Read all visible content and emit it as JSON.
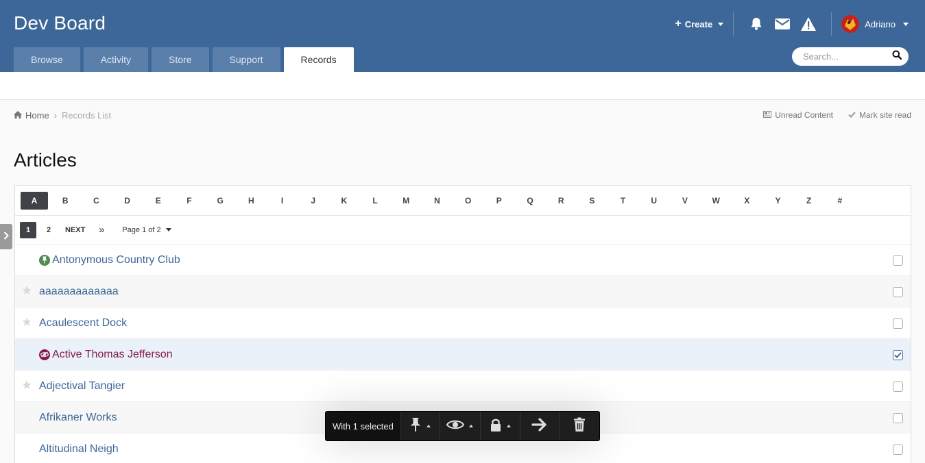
{
  "site": {
    "title": "Dev Board"
  },
  "header": {
    "create_label": "Create",
    "username": "Adriano",
    "search_placeholder": "Search..."
  },
  "tabs": [
    {
      "label": "Browse",
      "active": false
    },
    {
      "label": "Activity",
      "active": false
    },
    {
      "label": "Store",
      "active": false
    },
    {
      "label": "Support",
      "active": false
    },
    {
      "label": "Records",
      "active": true
    }
  ],
  "breadcrumb": {
    "home": "Home",
    "current": "Records List"
  },
  "top_links": {
    "unread": "Unread Content",
    "mark_read": "Mark site read"
  },
  "page": {
    "title": "Articles"
  },
  "letters": [
    "A",
    "B",
    "C",
    "D",
    "E",
    "F",
    "G",
    "H",
    "I",
    "J",
    "K",
    "L",
    "M",
    "N",
    "O",
    "P",
    "Q",
    "R",
    "S",
    "T",
    "U",
    "V",
    "W",
    "X",
    "Y",
    "Z",
    "#"
  ],
  "active_letter": "A",
  "pagination": {
    "pages": [
      "1",
      "2"
    ],
    "current": "1",
    "next": "NEXT",
    "last": "»",
    "info": "Page 1 of 2"
  },
  "records": [
    {
      "title": "Antonymous Country Club",
      "badge": "pinned",
      "star": false,
      "checked": false
    },
    {
      "title": "aaaaaaaaaaaaa",
      "badge": "",
      "star": true,
      "checked": false
    },
    {
      "title": "Acaulescent Dock",
      "badge": "",
      "star": true,
      "checked": false
    },
    {
      "title": "Active Thomas Jefferson",
      "badge": "hidden",
      "star": false,
      "checked": true
    },
    {
      "title": "Adjectival Tangier",
      "badge": "",
      "star": true,
      "checked": false
    },
    {
      "title": "Afrikaner Works",
      "badge": "",
      "star": false,
      "checked": false
    },
    {
      "title": "Altitudinal Neigh",
      "badge": "",
      "star": false,
      "checked": false
    }
  ],
  "moderation": {
    "selected_label": "With 1 selected",
    "actions": [
      "pin-icon",
      "eye-icon",
      "lock-icon",
      "move-arrow-icon",
      "trash-icon"
    ]
  },
  "colors": {
    "header": "#3e6799",
    "link": "#3e6799",
    "hidden_link": "#851d4a",
    "pinned_badge": "#4f8a4f"
  }
}
